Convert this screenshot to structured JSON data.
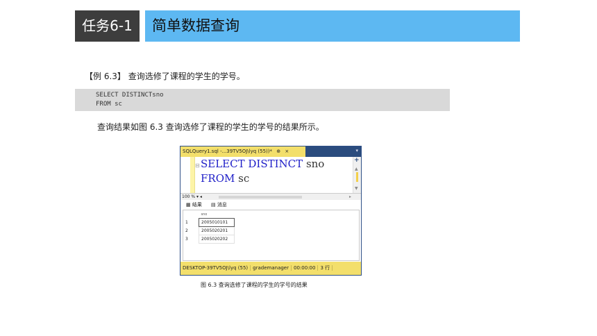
{
  "header": {
    "task": "任务6-1",
    "title": "简单数据查询"
  },
  "example": {
    "text": "【例 6.3】 查询选修了课程的学生的学号。"
  },
  "code": {
    "lines": [
      "SELECT DISTINCTsno",
      "FROM sc"
    ]
  },
  "description": "查询结果如图 6.3 查询选修了课程的学生的学号的结果所示。",
  "ssms": {
    "tab_title": "SQLQuery1.sql -...39TV5OJ\\lyq (55))*",
    "pin_glyph": "⊕",
    "close_glyph": "×",
    "editor": {
      "line1_keyword": "SELECT DISTINCT",
      "line1_ident": "sno",
      "line2_keyword": "FROM",
      "line2_ident": "sc"
    },
    "zoom": "100 %",
    "results_tab": "结果",
    "messages_tab": "消息",
    "column_header": "sno",
    "rows": [
      {
        "num": "1",
        "sno": "2005010101"
      },
      {
        "num": "2",
        "sno": "2005020201"
      },
      {
        "num": "3",
        "sno": "2005020202"
      }
    ],
    "status": {
      "server": "DESKTOP-39TV5OJ\\lyq (55)",
      "database": "grademanager",
      "time": "00:00:00",
      "rows": "3 行"
    }
  },
  "caption": "图 6.3   查询选修了课程的学生的学号的结果",
  "colors": {
    "header_dark": "#3d3d3d",
    "header_blue": "#5db8f2",
    "code_bg": "#d9d9d9",
    "ssms_yellow": "#f3df6b",
    "ssms_blue": "#2b4c7e"
  }
}
